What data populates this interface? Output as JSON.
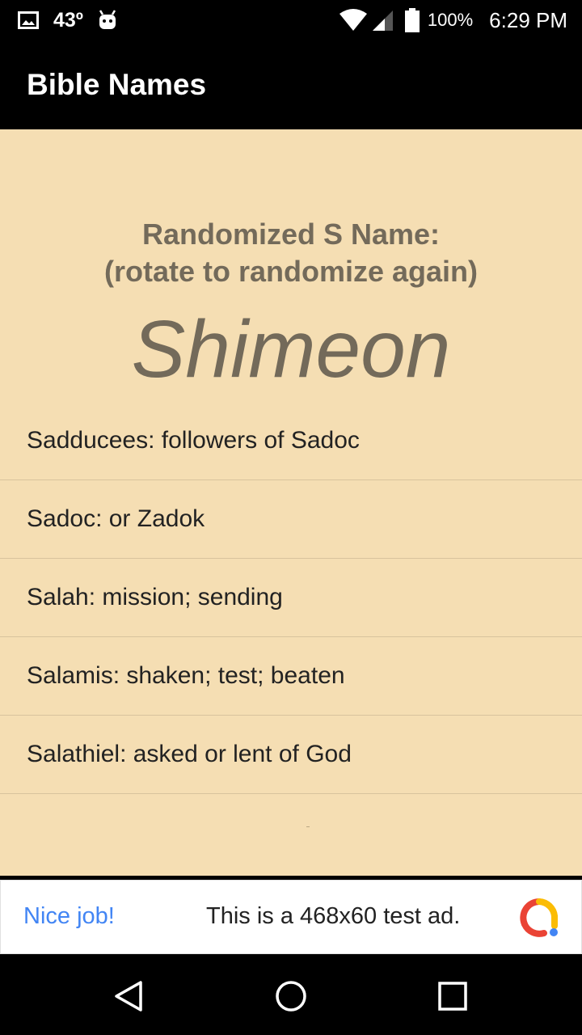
{
  "status_bar": {
    "temperature": "43º",
    "battery_percent": "100%",
    "time": "6:29 PM",
    "icons": [
      "image-icon",
      "android-icon",
      "wifi-icon",
      "cell-signal-icon",
      "battery-icon"
    ]
  },
  "app_bar": {
    "title": "Bible Names"
  },
  "main": {
    "heading_line1": "Randomized S Name:",
    "heading_line2": "(rotate to randomize again)",
    "random_name": "Shimeon",
    "names": [
      "Sadducees: followers of Sadoc",
      "Sadoc: or Zadok",
      "Salah: mission; sending",
      "Salamis: shaken; test; beaten",
      "Salathiel: asked or lent of God"
    ]
  },
  "ad": {
    "label": "Nice job!",
    "text": "This is a 468x60 test ad.",
    "logo_icon": "adchoices-logo-icon"
  },
  "nav": {
    "icons": [
      "back-icon",
      "home-icon",
      "recents-icon"
    ]
  },
  "colors": {
    "background": "#f5deb3",
    "heading": "#736a5a",
    "ad_label": "#4285f4"
  }
}
